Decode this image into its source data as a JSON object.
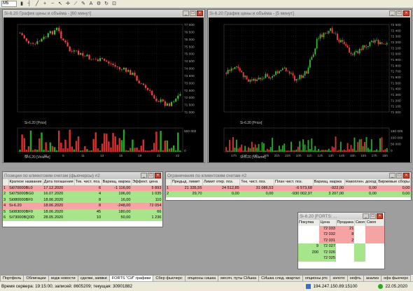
{
  "toolbar": {
    "timeframe": "M5"
  },
  "win1": {
    "title": "Si-6.20 График цены и объёма - [60 минут]",
    "y_ticks": [
      "77 000",
      "76 500",
      "76 000",
      "75 500",
      "75 000",
      "74 500",
      "74 000",
      "73 500",
      "73 000",
      "72 500",
      "72 000",
      "71 500",
      "71 000"
    ],
    "price_label": "Si-6.20 [Price]",
    "volume_label": "Si-6.20 [Volume]",
    "vol_ticks": [
      "500 000",
      "0"
    ],
    "x_ticks": [
      "28",
      "30",
      "5",
      "11",
      "13",
      "15",
      "19",
      "21",
      "22"
    ],
    "month": "Мар"
  },
  "win2": {
    "title": "Si-6.20 График цены и объёма - [5 минут]",
    "y_ticks": [
      "72 500",
      "72 400",
      "72 300",
      "72 200",
      "72 100",
      "72 000",
      "71 900",
      "71 800",
      "71 700",
      "71 600",
      "71 500",
      "71 400",
      "71 300",
      "71 200",
      "71 100",
      "71 000"
    ],
    "price_label": "Si-6.20 [Price]",
    "volume_label": "Si-6.20 [Volume]",
    "vol_ticks": [
      "150 000",
      "100 000",
      "50 000",
      "0"
    ],
    "x_ticks": [
      "17h",
      "18h",
      "19h",
      "20h",
      "21h",
      "22h",
      "10h",
      "11h",
      "12h",
      "13h",
      "14h",
      "15h",
      "16h",
      "17h",
      "18h"
    ]
  },
  "positions": {
    "title": "Позиции по клиентским счетам (фьючерсы) #2",
    "headers": [
      "",
      "Краткое название",
      "Дата погашения",
      "Тек. чист. поз.",
      "Вариац. маржа",
      "Эффект. цена"
    ],
    "rows": [
      {
        "n": "1",
        "name": "Si070000BL0",
        "date": "17.12.2020",
        "pos": "6",
        "vm": "-1 116,00",
        "price": "5 893",
        "cls": "red"
      },
      {
        "n": "2",
        "name": "Si075000BG0",
        "date": "16.07.2020",
        "pos": "4",
        "vm": "196,00",
        "price": "1 035",
        "cls": "grn"
      },
      {
        "n": "3",
        "name": "Si080000BF0",
        "date": "18.06.2020",
        "pos": "8",
        "vm": "16,00",
        "price": "110",
        "cls": "grn"
      },
      {
        "n": "4",
        "name": "Si-6.20",
        "date": "18.06.2020",
        "pos": "8",
        "vm": "-248,00",
        "price": "72 054",
        "cls": "red"
      },
      {
        "n": "5",
        "name": "Si083000BF0",
        "date": "18.06.2020",
        "pos": "45",
        "vm": "180,00",
        "price": "66",
        "cls": "grn"
      },
      {
        "n": "6",
        "name": "Si73000BQ0D",
        "date": "28.05.2020",
        "pos": "10",
        "vm": "50,00",
        "price": "1 236",
        "cls": "grn"
      }
    ]
  },
  "limits": {
    "title": "Ограничения по клиентским счетам #2",
    "headers": [
      "",
      "Предыд. лимит",
      "Лимит откр. поз.",
      "Тек. чист. поз.",
      "План чист. поз.",
      "Вариац. маржа",
      "Накоплен. доход",
      "Биржевые сборы"
    ],
    "rows": [
      {
        "n": "1",
        "a": "21 335,55",
        "b": "24 512,85",
        "c": "31 086,53",
        "d": "-6 573,68",
        "e": "-922,00",
        "f": "0,00",
        "g": "0,00",
        "cls": "red"
      },
      {
        "n": "2",
        "a": "29,70",
        "b": "0,00",
        "c": "0,00",
        "d": "-930 002,97",
        "e": "3 207,00",
        "f": "0,00",
        "g": "0,00",
        "cls": "grn"
      }
    ]
  },
  "orderbook": {
    "title": "Si-6.20 [FORTS: ...",
    "headers": [
      "Покупка",
      "Цена",
      "Продажа",
      "Своя",
      "Своя"
    ],
    "rows": [
      {
        "buy": "",
        "price": "72 033",
        "sell": "21",
        "side": "s"
      },
      {
        "buy": "",
        "price": "72 032",
        "sell": "8",
        "side": "s"
      },
      {
        "buy": "",
        "price": "72 031",
        "sell": "2",
        "side": "s"
      },
      {
        "buy": "9",
        "price": "72 027",
        "sell": "",
        "side": "b"
      },
      {
        "buy": "200",
        "price": "72 026",
        "sell": "",
        "side": "b"
      },
      {
        "buy": "",
        "price": "72 025",
        "sell": "",
        "side": "b"
      }
    ]
  },
  "tabs": [
    "Портфель",
    "Облигации",
    "хедж новости",
    "сделки, заявки",
    "FORTS \"СИ\" графики",
    "Сбер фьючерс",
    "опционы сишка",
    "месяч. путы СИшка",
    "СИшка след. квартал",
    "опционы ртс",
    "золото",
    "нефть",
    "анализ",
    "офз фьючерс"
  ],
  "status": {
    "server_time": "Время сервера: 19:15:00; записей: 8605209; текущая: 30901882",
    "ip": "194.247.150.89:15100",
    "date": "22.05.2020"
  },
  "colors": {
    "up": "#36c436",
    "down": "#ff4040",
    "volume_up": "#27a327",
    "volume_down": "#d23030"
  }
}
